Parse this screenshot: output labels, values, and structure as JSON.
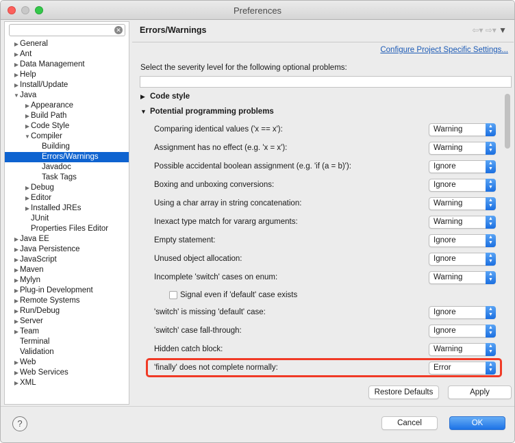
{
  "window": {
    "title": "Preferences"
  },
  "filter": {
    "value": "",
    "clear_icon": "clear-icon"
  },
  "tree": [
    {
      "label": "General",
      "indent": 0,
      "expander": "closed"
    },
    {
      "label": "Ant",
      "indent": 0,
      "expander": "closed"
    },
    {
      "label": "Data Management",
      "indent": 0,
      "expander": "closed"
    },
    {
      "label": "Help",
      "indent": 0,
      "expander": "closed"
    },
    {
      "label": "Install/Update",
      "indent": 0,
      "expander": "closed"
    },
    {
      "label": "Java",
      "indent": 0,
      "expander": "open"
    },
    {
      "label": "Appearance",
      "indent": 1,
      "expander": "closed"
    },
    {
      "label": "Build Path",
      "indent": 1,
      "expander": "closed"
    },
    {
      "label": "Code Style",
      "indent": 1,
      "expander": "closed"
    },
    {
      "label": "Compiler",
      "indent": 1,
      "expander": "open"
    },
    {
      "label": "Building",
      "indent": 2,
      "expander": "none"
    },
    {
      "label": "Errors/Warnings",
      "indent": 2,
      "expander": "none",
      "selected": true
    },
    {
      "label": "Javadoc",
      "indent": 2,
      "expander": "none"
    },
    {
      "label": "Task Tags",
      "indent": 2,
      "expander": "none"
    },
    {
      "label": "Debug",
      "indent": 1,
      "expander": "closed"
    },
    {
      "label": "Editor",
      "indent": 1,
      "expander": "closed"
    },
    {
      "label": "Installed JREs",
      "indent": 1,
      "expander": "closed"
    },
    {
      "label": "JUnit",
      "indent": 1,
      "expander": "none"
    },
    {
      "label": "Properties Files Editor",
      "indent": 1,
      "expander": "none"
    },
    {
      "label": "Java EE",
      "indent": 0,
      "expander": "closed"
    },
    {
      "label": "Java Persistence",
      "indent": 0,
      "expander": "closed"
    },
    {
      "label": "JavaScript",
      "indent": 0,
      "expander": "closed"
    },
    {
      "label": "Maven",
      "indent": 0,
      "expander": "closed"
    },
    {
      "label": "Mylyn",
      "indent": 0,
      "expander": "closed"
    },
    {
      "label": "Plug-in Development",
      "indent": 0,
      "expander": "closed"
    },
    {
      "label": "Remote Systems",
      "indent": 0,
      "expander": "closed"
    },
    {
      "label": "Run/Debug",
      "indent": 0,
      "expander": "closed"
    },
    {
      "label": "Server",
      "indent": 0,
      "expander": "closed"
    },
    {
      "label": "Team",
      "indent": 0,
      "expander": "closed"
    },
    {
      "label": "Terminal",
      "indent": 0,
      "expander": "none"
    },
    {
      "label": "Validation",
      "indent": 0,
      "expander": "none"
    },
    {
      "label": "Web",
      "indent": 0,
      "expander": "closed"
    },
    {
      "label": "Web Services",
      "indent": 0,
      "expander": "closed"
    },
    {
      "label": "XML",
      "indent": 0,
      "expander": "closed"
    }
  ],
  "page": {
    "title": "Errors/Warnings",
    "config_link": "Configure Project Specific Settings...",
    "severity_label": "Select the severity level for the following optional problems:",
    "search_value": ""
  },
  "sections": {
    "code_style": "Code style",
    "potential": "Potential programming problems"
  },
  "options": [
    {
      "label": "Comparing identical values ('x == x'):",
      "value": "Warning"
    },
    {
      "label": "Assignment has no effect (e.g. 'x = x'):",
      "value": "Warning"
    },
    {
      "label": "Possible accidental boolean assignment (e.g. 'if (a = b)'):",
      "value": "Ignore"
    },
    {
      "label": "Boxing and unboxing conversions:",
      "value": "Ignore"
    },
    {
      "label": "Using a char array in string concatenation:",
      "value": "Warning"
    },
    {
      "label": "Inexact type match for vararg arguments:",
      "value": "Warning"
    },
    {
      "label": "Empty statement:",
      "value": "Ignore"
    },
    {
      "label": "Unused object allocation:",
      "value": "Ignore"
    },
    {
      "label": "Incomplete 'switch' cases on enum:",
      "value": "Warning"
    }
  ],
  "checkbox": {
    "label": "Signal even if 'default' case exists",
    "checked": false
  },
  "options2": [
    {
      "label": "'switch' is missing 'default' case:",
      "value": "Ignore"
    },
    {
      "label": "'switch' case fall-through:",
      "value": "Ignore"
    },
    {
      "label": "Hidden catch block:",
      "value": "Warning"
    },
    {
      "label": "'finally' does not complete normally:",
      "value": "Error",
      "highlighted": true
    }
  ],
  "buttons": {
    "restore_defaults": "Restore Defaults",
    "apply": "Apply",
    "cancel": "Cancel",
    "ok": "OK",
    "help": "?"
  },
  "colors": {
    "selection": "#0e63d0",
    "link": "#1c5ab5",
    "highlight_border": "#f03a26",
    "primary_button": "#1d72e6"
  }
}
